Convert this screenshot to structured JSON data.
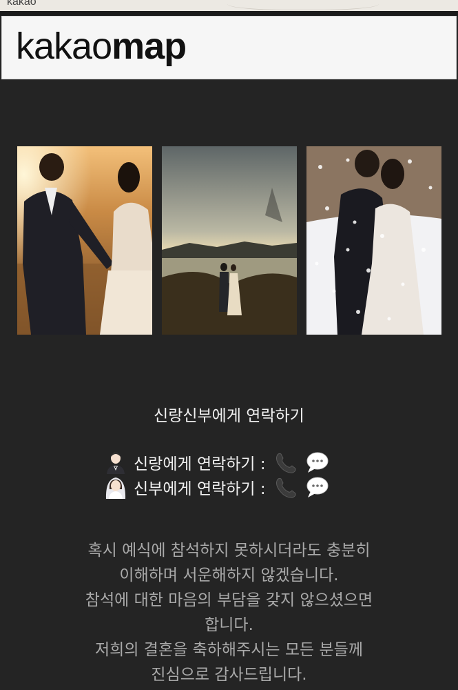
{
  "map": {
    "attribution": "kakao",
    "logo_light": "kakao",
    "logo_bold": "map"
  },
  "gallery": {
    "photos": [
      {
        "subject": "couple-sunset-field-photo"
      },
      {
        "subject": "couple-lakeside-photo"
      },
      {
        "subject": "couple-snow-kiss-photo"
      }
    ]
  },
  "contact": {
    "title": "신랑신부에게 연락하기",
    "groom": {
      "label": "신랑에게 연락하기 :",
      "avatar_icon": "groom-avatar-icon",
      "call_icon": "phone-icon",
      "message_icon": "speech-bubble-icon"
    },
    "bride": {
      "label": "신부에게 연락하기 :",
      "avatar_icon": "bride-avatar-icon",
      "call_icon": "phone-icon",
      "message_icon": "speech-bubble-icon"
    }
  },
  "message": {
    "lines": [
      "혹시 예식에 참석하지 못하시더라도 충분히",
      "이해하며 서운해하지 않겠습니다.",
      "참석에 대한 마음의 부담을 갖지 않으셨으면",
      "합니다.",
      "저희의 결혼을 축하해주시는 모든 분들께",
      "진심으로 감사드립니다."
    ]
  },
  "colors": {
    "background": "#242424",
    "title_text": "#f0f0f0",
    "message_text": "#a9a9a9"
  }
}
